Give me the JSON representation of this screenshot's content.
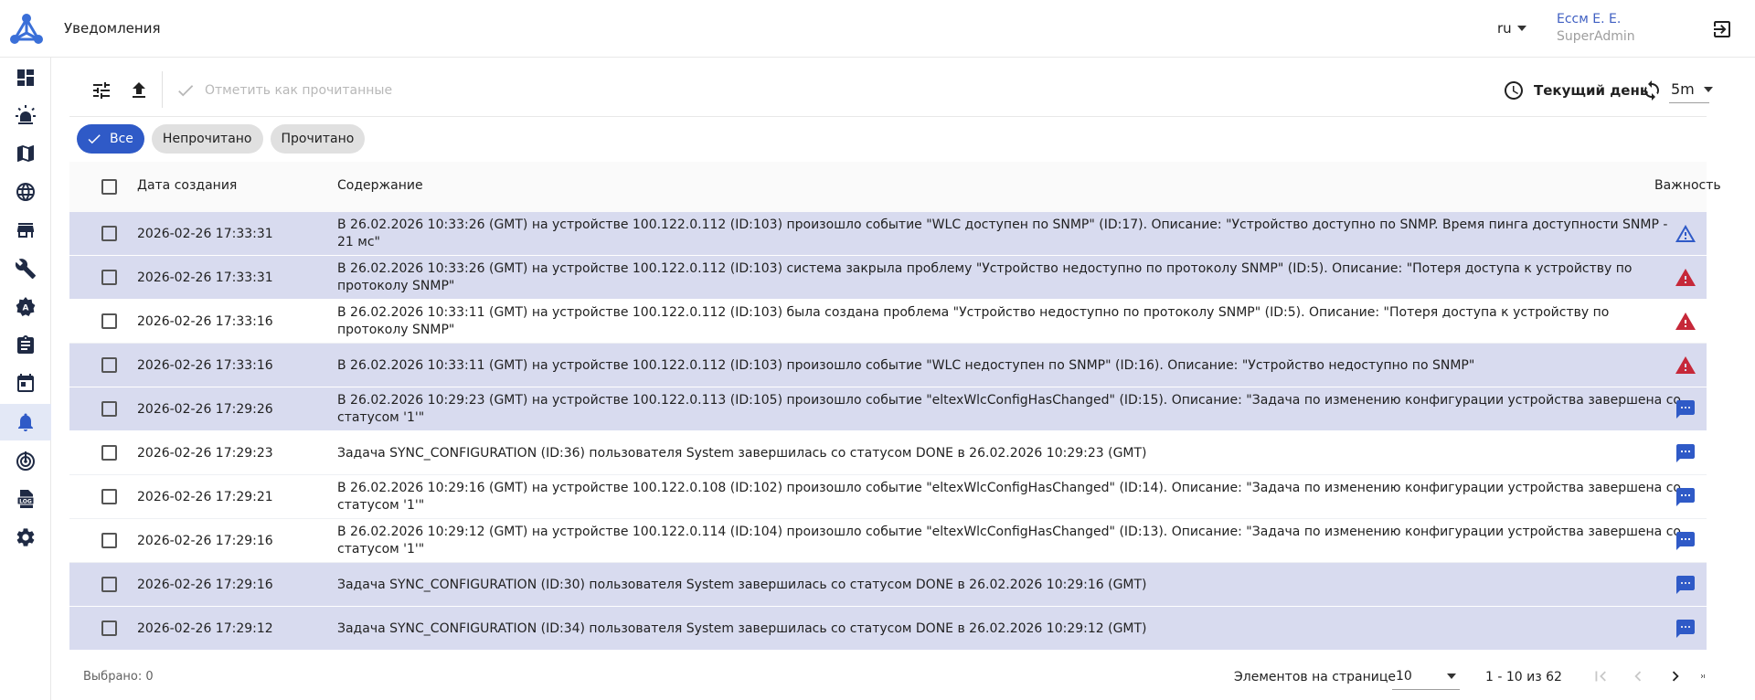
{
  "app": {
    "page_title": "Уведомления",
    "language": "ru",
    "user_name": "Ессм Е. Е.",
    "user_role": "SuperAdmin"
  },
  "toolbar": {
    "mark_read_label": "Отметить как прочитанные",
    "period_label": "Текущий день",
    "interval_value": "5m"
  },
  "filters": [
    {
      "label": "Все",
      "active": true
    },
    {
      "label": "Непрочитано",
      "active": false
    },
    {
      "label": "Прочитано",
      "active": false
    }
  ],
  "table": {
    "headers": {
      "date": "Дата создания",
      "content": "Содержание",
      "severity": "Важность"
    },
    "rows": [
      {
        "date": "2026-02-26 17:33:31",
        "content": "В 26.02.2026 10:33:26 (GMT) на устройстве 100.122.0.112 (ID:103) произошло событие \"WLC доступен по SNMP\" (ID:17). Описание: \"Устройство доступно по SNMP. Время пинга доступности SNMP - 21 мс\"",
        "severity": "warning-outline",
        "unread": true
      },
      {
        "date": "2026-02-26 17:33:31",
        "content": "В 26.02.2026 10:33:26 (GMT) на устройстве 100.122.0.112 (ID:103) система закрыла проблему \"Устройство недоступно по протоколу SNMP\" (ID:5). Описание: \"Потеря доступа к устройству по протоколу SNMP\"",
        "severity": "warning-red",
        "unread": true
      },
      {
        "date": "2026-02-26 17:33:16",
        "content": "В 26.02.2026 10:33:11 (GMT) на устройстве 100.122.0.112 (ID:103) была создана проблема \"Устройство недоступно по протоколу SNMP\" (ID:5). Описание: \"Потеря доступа к устройству по протоколу SNMP\"",
        "severity": "warning-red",
        "unread": false
      },
      {
        "date": "2026-02-26 17:33:16",
        "content": "В 26.02.2026 10:33:11 (GMT) на устройстве 100.122.0.112 (ID:103) произошло событие \"WLC недоступен по SNMP\" (ID:16). Описание: \"Устройство недоступно по SNMP\"",
        "severity": "warning-red",
        "unread": true
      },
      {
        "date": "2026-02-26 17:29:26",
        "content": "В 26.02.2026 10:29:23 (GMT) на устройстве 100.122.0.113 (ID:105) произошло событие \"eltexWlcConfigHasChanged\" (ID:15). Описание: \"Задача по изменению конфигурации устройства завершена со статусом '1'\"",
        "severity": "message",
        "unread": true
      },
      {
        "date": "2026-02-26 17:29:23",
        "content": "Задача SYNC_CONFIGURATION (ID:36) пользователя System завершилась со статусом DONE в 26.02.2026 10:29:23 (GMT)",
        "severity": "message",
        "unread": false
      },
      {
        "date": "2026-02-26 17:29:21",
        "content": "В 26.02.2026 10:29:16 (GMT) на устройстве 100.122.0.108 (ID:102) произошло событие \"eltexWlcConfigHasChanged\" (ID:14). Описание: \"Задача по изменению конфигурации устройства завершена со статусом '1'\"",
        "severity": "message",
        "unread": false
      },
      {
        "date": "2026-02-26 17:29:16",
        "content": "В 26.02.2026 10:29:12 (GMT) на устройстве 100.122.0.114 (ID:104) произошло событие \"eltexWlcConfigHasChanged\" (ID:13). Описание: \"Задача по изменению конфигурации устройства завершена со статусом '1'\"",
        "severity": "message",
        "unread": false
      },
      {
        "date": "2026-02-26 17:29:16",
        "content": "Задача SYNC_CONFIGURATION (ID:30) пользователя System завершилась со статусом DONE в 26.02.2026 10:29:16 (GMT)",
        "severity": "message",
        "unread": true
      },
      {
        "date": "2026-02-26 17:29:12",
        "content": "Задача SYNC_CONFIGURATION (ID:34) пользователя System завершилась со статусом DONE в 26.02.2026 10:29:12 (GMT)",
        "severity": "message",
        "unread": true
      }
    ]
  },
  "footer": {
    "selected_label": "Выбрано: 0",
    "per_page_label": "Элементов на странице",
    "per_page_value": "10",
    "range_label": "1 - 10 из 62"
  },
  "colors": {
    "accent": "#2f5ac7",
    "unread_row": "#d8dbef",
    "severity_red": "#c62839",
    "severity_blue": "#2f5ac7",
    "sidebar_icon": "#1f2a44"
  },
  "sidebar_icons": [
    "dashboard-icon",
    "alarm-light-icon",
    "map-icon",
    "globe-icon",
    "store-icon",
    "wrench-icon",
    "admin-badge-icon",
    "clipboard-icon",
    "calendar-icon",
    "bell-icon",
    "radar-icon",
    "log-icon",
    "gear-icon"
  ]
}
